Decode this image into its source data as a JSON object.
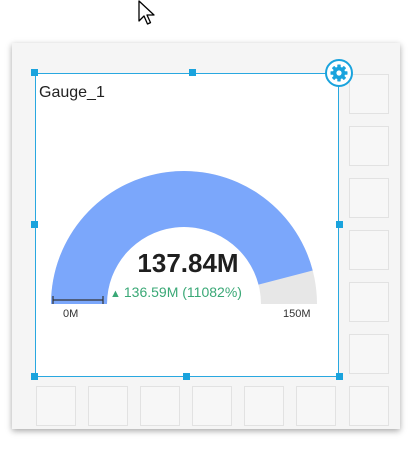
{
  "widget": {
    "title": "Gauge_1",
    "value": "137.84M",
    "delta": "136.59M (11082%)",
    "delta_direction": "up",
    "min_label": "0M",
    "max_label": "150M",
    "value_fraction": 0.919,
    "target_fraction": 0.0083
  },
  "colors": {
    "gauge_fill": "#7ba7fb",
    "gauge_track": "#e7e7e7",
    "delta_positive": "#3aa876",
    "selection_border": "#29a8e0"
  },
  "icons": {
    "settings": "gear-icon",
    "cursor": "mouse-pointer-icon",
    "delta": "triangle-up-icon"
  }
}
